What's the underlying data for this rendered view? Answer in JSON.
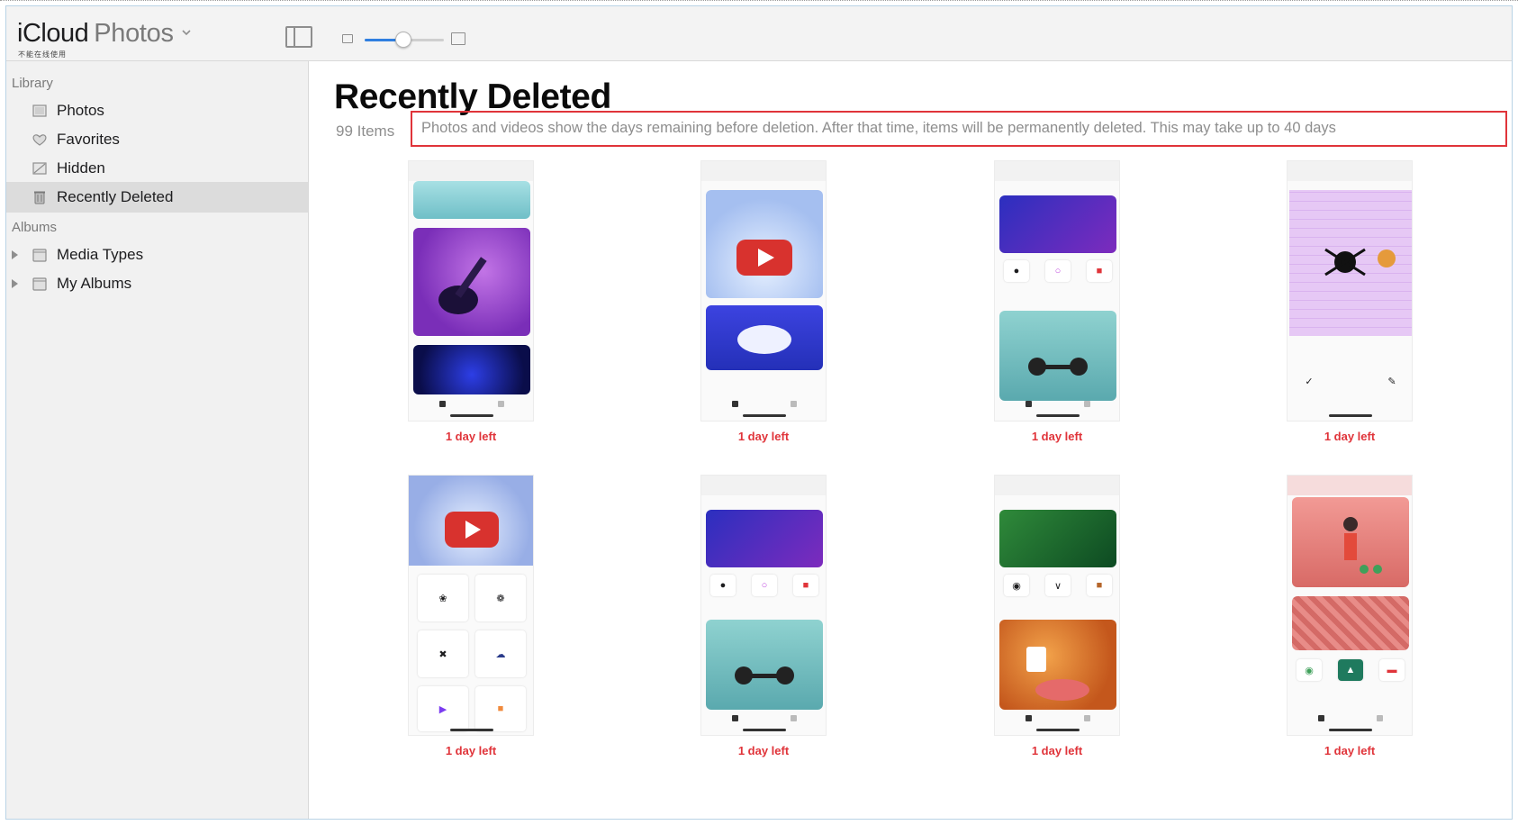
{
  "app": {
    "brand_primary": "iCloud",
    "brand_secondary": "Photos",
    "brand_subtitle": "不能在线使用"
  },
  "sidebar": {
    "library_label": "Library",
    "library_items": [
      {
        "label": "Photos",
        "icon": "photos-icon"
      },
      {
        "label": "Favorites",
        "icon": "heart-icon"
      },
      {
        "label": "Hidden",
        "icon": "hidden-icon"
      },
      {
        "label": "Recently Deleted",
        "icon": "trash-icon",
        "selected": true
      }
    ],
    "albums_label": "Albums",
    "album_items": [
      {
        "label": "Media Types",
        "icon": "folder-icon"
      },
      {
        "label": "My Albums",
        "icon": "folder-icon"
      }
    ]
  },
  "main": {
    "title": "Recently Deleted",
    "item_count": "99 Items",
    "notice": "Photos and videos show the days remaining before deletion. After that time, items will be permanently deleted. This may take up to 40 days",
    "thumbnails": [
      {
        "days_left": "1 day left",
        "theme": "guitar"
      },
      {
        "days_left": "1 day left",
        "theme": "youtube-gamepad"
      },
      {
        "days_left": "1 day left",
        "theme": "social-fitness"
      },
      {
        "days_left": "1 day left",
        "theme": "spider-editor"
      },
      {
        "days_left": "1 day left",
        "theme": "youtube-icons"
      },
      {
        "days_left": "1 day left",
        "theme": "social-fitness-2"
      },
      {
        "days_left": "1 day left",
        "theme": "nature-coffee"
      },
      {
        "days_left": "1 day left",
        "theme": "person-pipes"
      }
    ]
  },
  "colors": {
    "accent": "#2f7fe0",
    "days_left": "#e0343a",
    "highlight_box": "#e0343a",
    "sidebar_bg": "#f1f1f1",
    "selected_bg": "#dcdcdc"
  },
  "zoom_level": 0.45
}
